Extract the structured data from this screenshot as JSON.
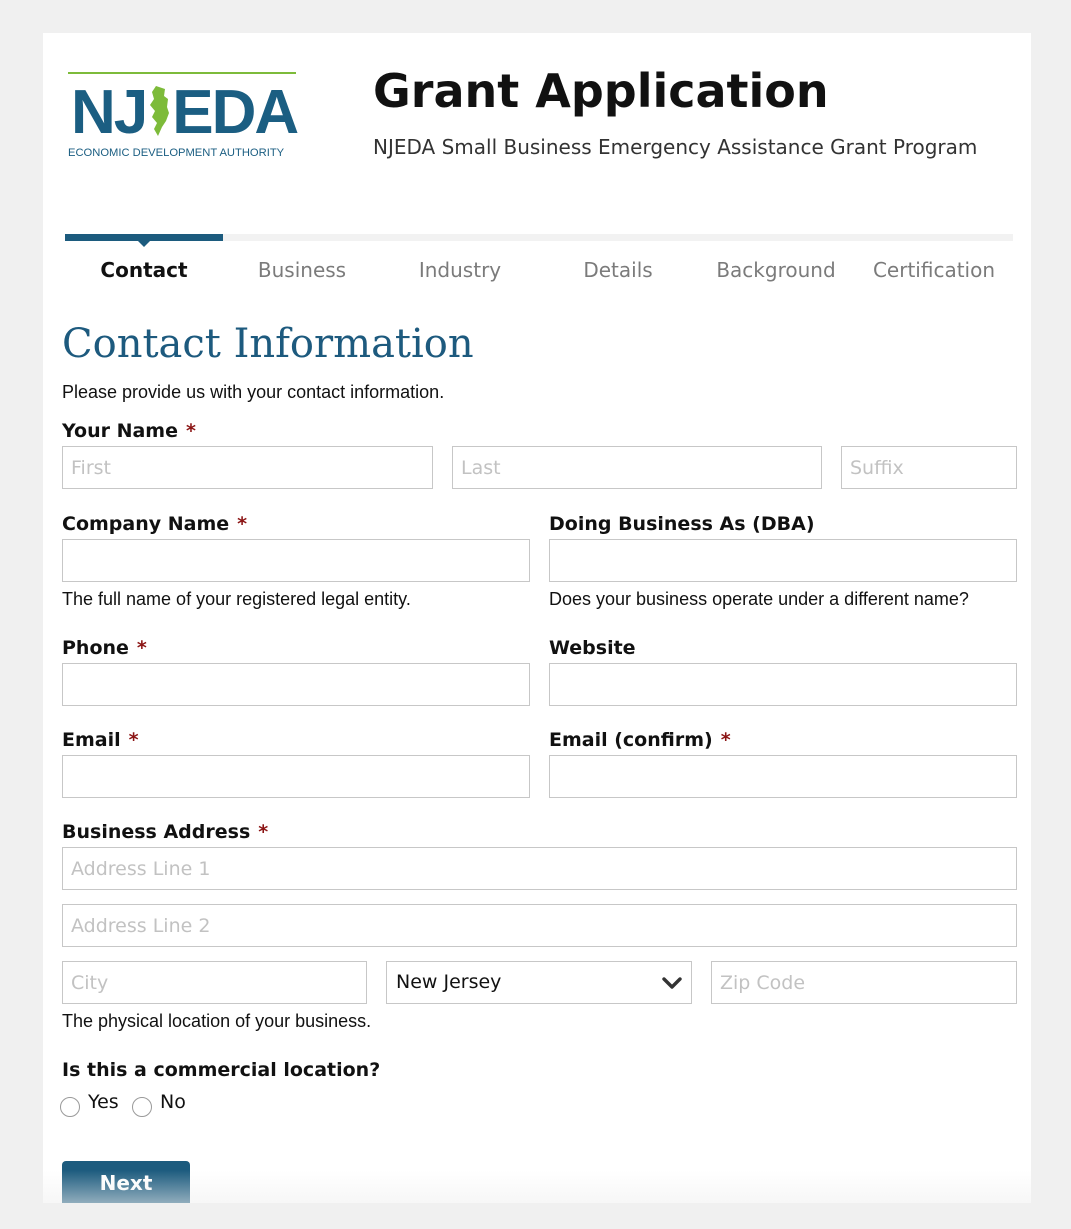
{
  "header": {
    "logo_mark": "NJEDA",
    "logo_subtitle": "ECONOMIC DEVELOPMENT AUTHORITY",
    "title": "Grant Application",
    "subtitle": "NJEDA Small Business Emergency Assistance Grant Program"
  },
  "tabs": [
    {
      "label": "Contact",
      "active": true
    },
    {
      "label": "Business",
      "active": false
    },
    {
      "label": "Industry",
      "active": false
    },
    {
      "label": "Details",
      "active": false
    },
    {
      "label": "Background",
      "active": false
    },
    {
      "label": "Certification",
      "active": false
    }
  ],
  "section": {
    "title": "Contact Information",
    "intro": "Please provide us with your contact information."
  },
  "form": {
    "name": {
      "label": "Your Name",
      "required_mark": "*",
      "first_placeholder": "First",
      "last_placeholder": "Last",
      "suffix_placeholder": "Suffix"
    },
    "company": {
      "label": "Company Name",
      "required_mark": "*",
      "help": "The full name of your registered legal entity.",
      "value": ""
    },
    "dba": {
      "label": "Doing Business As (DBA)",
      "help": "Does your business operate under a different name?",
      "value": ""
    },
    "phone": {
      "label": "Phone",
      "required_mark": "*",
      "value": ""
    },
    "website": {
      "label": "Website",
      "value": ""
    },
    "email": {
      "label": "Email",
      "required_mark": "*",
      "value": ""
    },
    "email_confirm": {
      "label": "Email (confirm)",
      "required_mark": "*",
      "value": ""
    },
    "address": {
      "label": "Business Address",
      "required_mark": "*",
      "line1_placeholder": "Address Line 1",
      "line2_placeholder": "Address Line 2",
      "city_placeholder": "City",
      "state_value": "New Jersey",
      "zip_placeholder": "Zip Code",
      "help": "The physical location of your business."
    },
    "commercial": {
      "label": "Is this a commercial location?",
      "options": [
        "Yes",
        "No"
      ],
      "selected": null
    }
  },
  "actions": {
    "next_label": "Next"
  },
  "colors": {
    "brand_blue": "#1c5b7e",
    "required_red": "#8b1414",
    "logo_green": "#7dbb3a",
    "page_bg": "#f0f0f0"
  },
  "icons": {
    "select_arrow": "chevron-down-icon",
    "logo_state": "new-jersey-state-icon"
  }
}
